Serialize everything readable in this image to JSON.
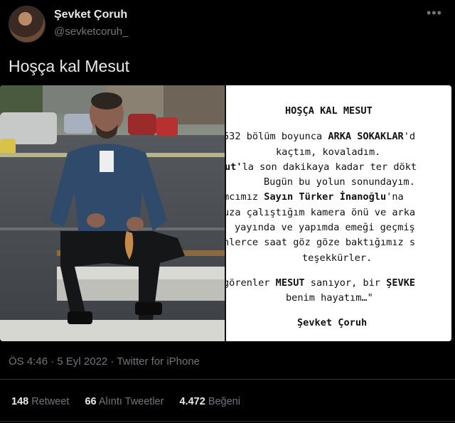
{
  "author": {
    "name": "Şevket Çoruh",
    "handle": "@sevketcoruh_"
  },
  "tweet": {
    "text": "Hoşça kal Mesut",
    "timestamp": "ÖS 4:46 · 5 Eyl 2022 · Twitter for iPhone"
  },
  "letter": {
    "title": "HOŞÇA KAL MESUT",
    "l1a": "532 bölüm boyunca ",
    "l1b": "ARKA SOKAKLAR",
    "l1c": "'d",
    "l2": "kaçtım, kovaladım.",
    "l3a": "ut'",
    "l3b": "la son dakikaya kadar ter dökt",
    "l4": "Bugün bu yolun sonundayım.",
    "l5a": "mcımız ",
    "l5b": "Sayın Türker İnanoğlu",
    "l5c": "'na",
    "l6": "uza çalıştığım kamera önü ve arka",
    "l7": "yayında ve yapımda emeği geçmiş",
    "l8": "nlerce saat göz göze baktığımız s",
    "l9": "teşekkürler.",
    "l10a": "görenler ",
    "l10b": "MESUT",
    "l10c": " sanıyor, bir ",
    "l10d": "ŞEVKE",
    "l11": "benim hayatım…\"",
    "signature": "Şevket Çoruh"
  },
  "stats": {
    "retweets_count": "148",
    "retweets_label": "Retweet",
    "quotes_count": "66",
    "quotes_label": "Alıntı Tweetler",
    "likes_count": "4.472",
    "likes_label": "Beğeni"
  },
  "icons": {
    "more": "more-horizontal-icon"
  }
}
